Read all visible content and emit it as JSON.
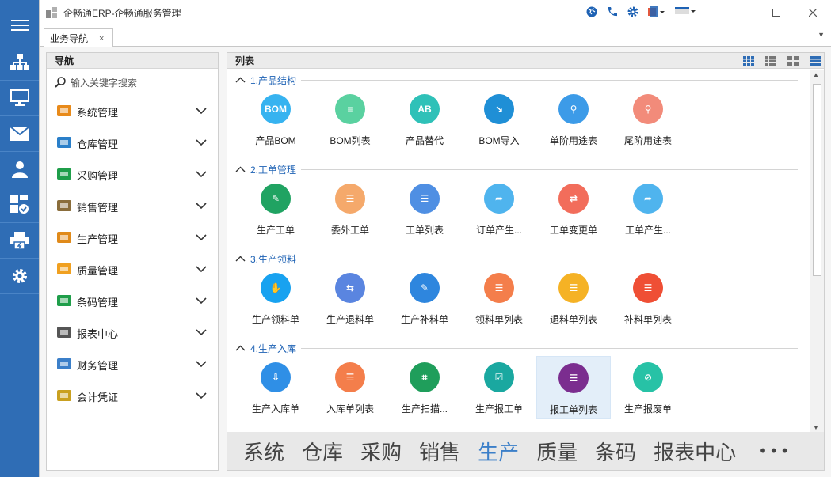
{
  "window": {
    "title": "企畅通ERP-企畅通服务管理"
  },
  "rail": {
    "items": [
      "menu-icon",
      "org-chart-icon",
      "monitor-icon",
      "mail-icon",
      "user-icon",
      "dashboard-check-icon",
      "printer-icon",
      "gear-icon"
    ]
  },
  "tab": {
    "label": "业务导航",
    "close": "×"
  },
  "nav": {
    "header": "导航",
    "search_placeholder": "输入关键字搜索",
    "items": [
      {
        "label": "系统管理",
        "icon": "system-gear-icon"
      },
      {
        "label": "仓库管理",
        "icon": "warehouse-icon"
      },
      {
        "label": "采购管理",
        "icon": "cart-icon"
      },
      {
        "label": "销售管理",
        "icon": "sales-chart-icon"
      },
      {
        "label": "生产管理",
        "icon": "production-icon"
      },
      {
        "label": "质量管理",
        "icon": "quality-icon"
      },
      {
        "label": "条码管理",
        "icon": "qrcode-icon"
      },
      {
        "label": "报表中心",
        "icon": "report-icon"
      },
      {
        "label": "财务管理",
        "icon": "finance-icon"
      },
      {
        "label": "会计凭证",
        "icon": "voucher-icon"
      }
    ]
  },
  "list": {
    "header": "列表",
    "sections": [
      {
        "title": "1.产品结构",
        "tiles": [
          {
            "label": "产品BOM",
            "color": "#37b3f0",
            "glyph": "BOM"
          },
          {
            "label": "BOM列表",
            "color": "#5ad1a0",
            "glyph": "≡"
          },
          {
            "label": "产品替代",
            "color": "#2fc1b8",
            "glyph": "AB"
          },
          {
            "label": "BOM导入",
            "color": "#1f8fd6",
            "glyph": "↘"
          },
          {
            "label": "单阶用途表",
            "color": "#3c9be8",
            "glyph": "⚲"
          },
          {
            "label": "尾阶用途表",
            "color": "#f28b7a",
            "glyph": "⚲"
          }
        ]
      },
      {
        "title": "2.工单管理",
        "tiles": [
          {
            "label": "生产工单",
            "color": "#20a362",
            "glyph": "✎"
          },
          {
            "label": "委外工单",
            "color": "#f5a96b",
            "glyph": "☰"
          },
          {
            "label": "工单列表",
            "color": "#4f8fe3",
            "glyph": "☰"
          },
          {
            "label": "订单产生...",
            "color": "#4fb4ee",
            "glyph": "➦"
          },
          {
            "label": "工单变更单",
            "color": "#f26d5b",
            "glyph": "⇄"
          },
          {
            "label": "工单产生...",
            "color": "#4fb4ee",
            "glyph": "➦"
          }
        ]
      },
      {
        "title": "3.生产领料",
        "tiles": [
          {
            "label": "生产领料单",
            "color": "#18a2f0",
            "glyph": "✋"
          },
          {
            "label": "生产退料单",
            "color": "#5a85e0",
            "glyph": "⇆"
          },
          {
            "label": "生产补料单",
            "color": "#2e86de",
            "glyph": "✎"
          },
          {
            "label": "领料单列表",
            "color": "#f47e4b",
            "glyph": "☰"
          },
          {
            "label": "退料单列表",
            "color": "#f5b225",
            "glyph": "☰"
          },
          {
            "label": "补料单列表",
            "color": "#ef4f35",
            "glyph": "☰"
          }
        ]
      },
      {
        "title": "4.生产入库",
        "tiles": [
          {
            "label": "生产入库单",
            "color": "#2f8fe6",
            "glyph": "⇩"
          },
          {
            "label": "入库单列表",
            "color": "#f47e4b",
            "glyph": "☰"
          },
          {
            "label": "生产扫描...",
            "color": "#1f9e5b",
            "glyph": "⌗"
          },
          {
            "label": "生产报工单",
            "color": "#1aa8a0",
            "glyph": "☑"
          },
          {
            "label": "报工单列表",
            "color": "#7b2d8f",
            "glyph": "☰"
          },
          {
            "label": "生产报废单",
            "color": "#27c2a6",
            "glyph": "⊘"
          }
        ]
      }
    ]
  },
  "modules": [
    "系统",
    "仓库",
    "采购",
    "销售",
    "生产",
    "质量",
    "条码",
    "报表中心",
    "•••"
  ],
  "active_module": "生产",
  "selected_tile": "报工单列表"
}
